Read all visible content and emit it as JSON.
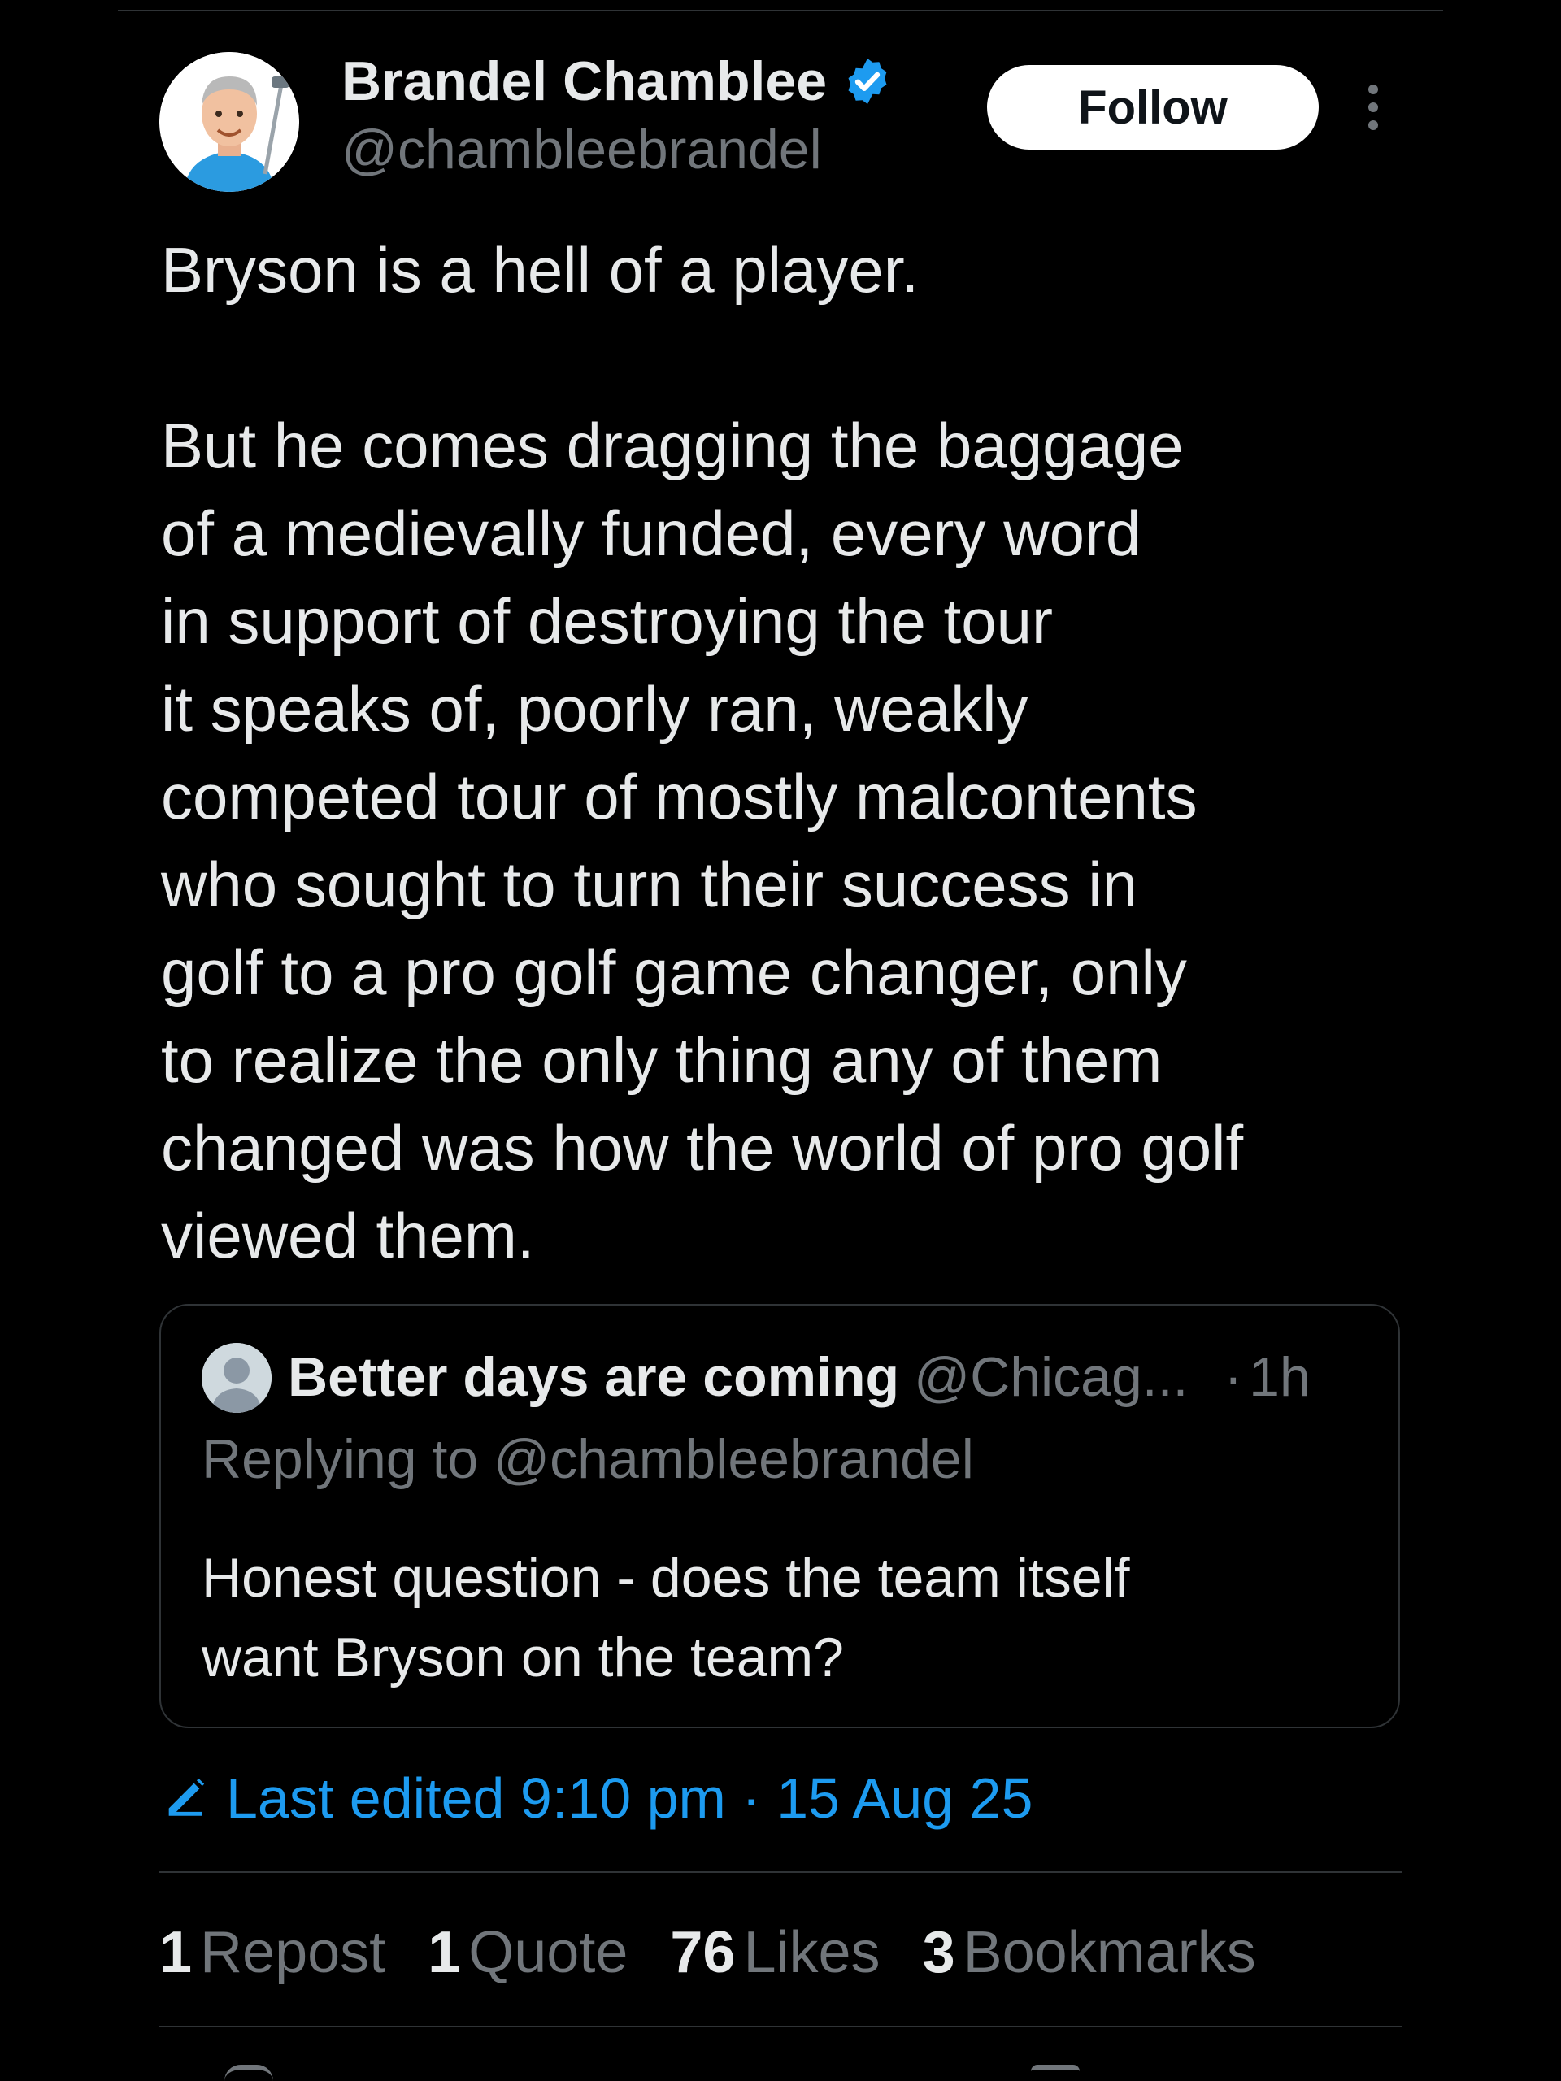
{
  "author": {
    "display_name": "Brandel Chamblee",
    "handle": "@chambleebrandel",
    "verified": true,
    "avatar_icon": "memoji-golfer-avatar"
  },
  "actions": {
    "follow_label": "Follow",
    "more_icon": "more-vertical-icon"
  },
  "tweet": {
    "text": "Bryson is a hell of a player.\n\nBut he comes dragging the baggage\nof a medievally funded, every word\nin support of destroying the tour\nit speaks of, poorly ran, weakly\ncompeted tour of mostly malcontents\nwho sought to turn their success in\ngolf to a pro golf game changer, only\nto realize the only thing any of them\nchanged was how the world of pro golf\nviewed them."
  },
  "quote": {
    "name": "Better days are coming",
    "handle": "@Chicag...",
    "separator": "·",
    "time": "1h",
    "replying_to": "Replying to @chambleebrandel",
    "text": "Honest question - does the team itself\nwant Bryson on the team?"
  },
  "edited": {
    "label": "Last edited 9:10 pm · 15 Aug 25",
    "icon": "edit-pencil-icon"
  },
  "stats": [
    {
      "count": "1",
      "label": "Repost"
    },
    {
      "count": "1",
      "label": "Quote"
    },
    {
      "count": "76",
      "label": "Likes"
    },
    {
      "count": "3",
      "label": "Bookmarks"
    }
  ],
  "colors": {
    "background": "#000000",
    "text_primary": "#e7e9ea",
    "text_secondary": "#71767b",
    "accent": "#1d9bf0",
    "divider": "#2f3336"
  }
}
